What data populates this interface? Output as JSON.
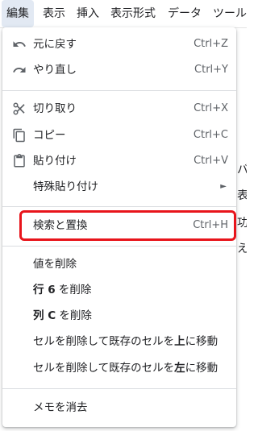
{
  "menubar": {
    "items": [
      "編集",
      "表示",
      "挿入",
      "表示形式",
      "データ",
      "ツール"
    ]
  },
  "backdrop": {
    "fragments": [
      "バ",
      "表",
      "功",
      "え"
    ]
  },
  "edit_menu": {
    "undo": {
      "label": "元に戻す",
      "shortcut": "Ctrl+Z",
      "icon": "undo-icon"
    },
    "redo": {
      "label": "やり直し",
      "shortcut": "Ctrl+Y",
      "icon": "redo-icon"
    },
    "cut": {
      "label": "切り取り",
      "shortcut": "Ctrl+X",
      "icon": "scissors-icon"
    },
    "copy": {
      "label": "コピー",
      "shortcut": "Ctrl+C",
      "icon": "copy-icon"
    },
    "paste": {
      "label": "貼り付け",
      "shortcut": "Ctrl+V",
      "icon": "clipboard-icon"
    },
    "paste_special": {
      "label": "特殊貼り付け",
      "submenu_icon": "submenu-arrow-icon"
    },
    "find_replace": {
      "label": "検索と置換",
      "shortcut": "Ctrl+H"
    },
    "delete_values": {
      "label": "値を削除"
    },
    "delete_row": {
      "prefix": "行 6",
      "suffix": " を削除"
    },
    "delete_column": {
      "prefix": "列 C",
      "suffix": " を削除"
    },
    "delete_cells_shift_up": {
      "pre": "セルを削除して既存のセルを",
      "dir": "上",
      "post": "に移動"
    },
    "delete_cells_shift_left": {
      "pre": "セルを削除して既存のセルを",
      "dir": "左",
      "post": "に移動"
    },
    "clear_notes": {
      "label": "メモを消去"
    }
  },
  "colors": {
    "highlight": "#e8141b",
    "active_menu": "#e2e9f3",
    "text": "#202124",
    "shortcut": "#5f6368"
  }
}
